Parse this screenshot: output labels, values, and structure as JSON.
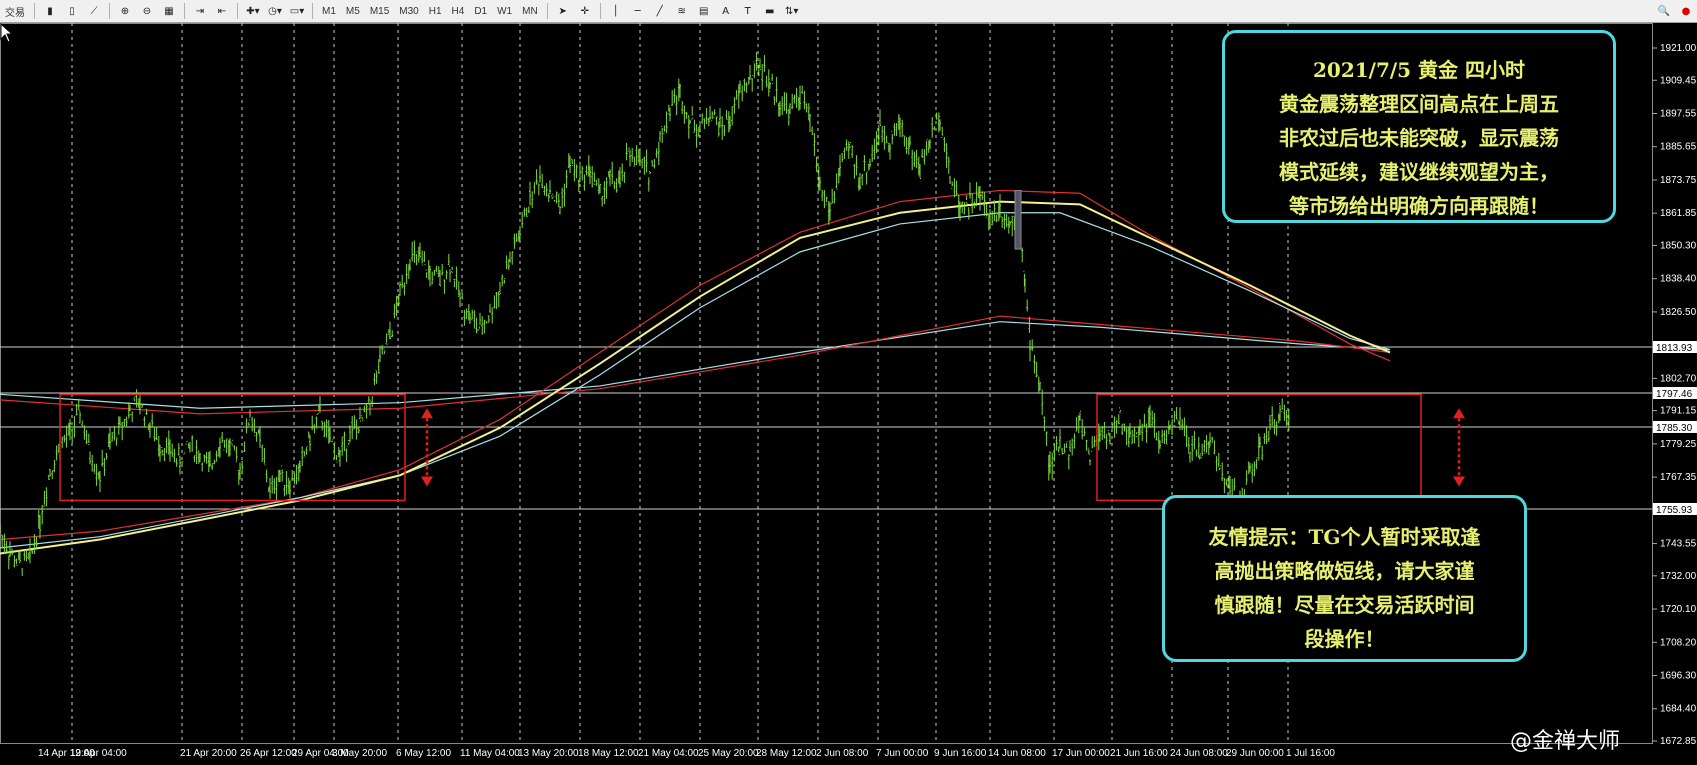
{
  "toolbar": {
    "left_label": "交易",
    "timeframes": [
      "M1",
      "M5",
      "M15",
      "M30",
      "H1",
      "H4",
      "D1",
      "W1",
      "MN"
    ],
    "text_tool": "A",
    "label_tool": "T"
  },
  "notes": {
    "top": {
      "lines": [
        "2021/7/5 黄金 四小时",
        "黄金震荡整理区间高点在上周五",
        "非农过后也未能突破，显示震荡",
        "模式延续，建议继续观望为主，",
        "等市场给出明确方向再跟随！"
      ]
    },
    "bottom": {
      "lines": [
        "友情提示：TG个人暂时采取逢",
        "高抛出策略做短线，请大家谨",
        "慎跟随！尽量在交易活跃时间",
        "段操作！"
      ]
    }
  },
  "watermark": "@金禅大师",
  "chart_data": {
    "type": "line",
    "ylim": [
      1672.85,
      1921.0
    ],
    "price_ticks": [
      1921.0,
      1909.45,
      1897.55,
      1885.65,
      1873.75,
      1861.85,
      1850.3,
      1838.4,
      1826.5,
      1802.7,
      1791.15,
      1779.25,
      1767.35,
      1755.45,
      1743.55,
      1732.0,
      1720.1,
      1708.2,
      1696.3,
      1684.4,
      1672.85
    ],
    "highlighted_prices": [
      1813.93,
      1797.46,
      1785.3,
      1755.93
    ],
    "x_labels": [
      "14 Apr 12:00",
      "19 Apr 04:00",
      "21 Apr 20:00",
      "26 Apr 12:00",
      "29 Apr 04:00",
      "3 May 20:00",
      "6 May 12:00",
      "11 May 04:00",
      "13 May 20:00",
      "18 May 12:00",
      "21 May 04:00",
      "25 May 20:00",
      "28 May 12:00",
      "2 Jun 08:00",
      "7 Jun 00:00",
      "9 Jun 16:00",
      "14 Jun 08:00",
      "17 Jun 00:00",
      "21 Jun 16:00",
      "24 Jun 08:00",
      "29 Jun 00:00",
      "1 Jul 16:00"
    ],
    "price_path": [
      [
        0,
        1748
      ],
      [
        10,
        1740
      ],
      [
        20,
        1736
      ],
      [
        30,
        1738
      ],
      [
        40,
        1752
      ],
      [
        50,
        1770
      ],
      [
        60,
        1778
      ],
      [
        70,
        1783
      ],
      [
        80,
        1790
      ],
      [
        90,
        1776
      ],
      [
        100,
        1768
      ],
      [
        110,
        1779
      ],
      [
        120,
        1785
      ],
      [
        130,
        1791
      ],
      [
        140,
        1794
      ],
      [
        150,
        1786
      ],
      [
        160,
        1779
      ],
      [
        170,
        1777
      ],
      [
        180,
        1773
      ],
      [
        190,
        1779
      ],
      [
        200,
        1775
      ],
      [
        210,
        1770
      ],
      [
        220,
        1781
      ],
      [
        230,
        1778
      ],
      [
        240,
        1770
      ],
      [
        250,
        1790
      ],
      [
        260,
        1780
      ],
      [
        270,
        1762
      ],
      [
        280,
        1768
      ],
      [
        290,
        1765
      ],
      [
        300,
        1770
      ],
      [
        310,
        1782
      ],
      [
        320,
        1790
      ],
      [
        330,
        1780
      ],
      [
        340,
        1775
      ],
      [
        350,
        1783
      ],
      [
        360,
        1786
      ],
      [
        370,
        1794
      ],
      [
        380,
        1808
      ],
      [
        390,
        1818
      ],
      [
        400,
        1833
      ],
      [
        410,
        1846
      ],
      [
        420,
        1845
      ],
      [
        430,
        1840
      ],
      [
        440,
        1838
      ],
      [
        450,
        1844
      ],
      [
        460,
        1832
      ],
      [
        470,
        1825
      ],
      [
        480,
        1820
      ],
      [
        490,
        1826
      ],
      [
        500,
        1835
      ],
      [
        510,
        1845
      ],
      [
        520,
        1855
      ],
      [
        530,
        1867
      ],
      [
        540,
        1875
      ],
      [
        550,
        1870
      ],
      [
        560,
        1864
      ],
      [
        570,
        1880
      ],
      [
        580,
        1874
      ],
      [
        590,
        1878
      ],
      [
        600,
        1868
      ],
      [
        610,
        1874
      ],
      [
        620,
        1872
      ],
      [
        630,
        1884
      ],
      [
        640,
        1880
      ],
      [
        650,
        1876
      ],
      [
        660,
        1888
      ],
      [
        670,
        1900
      ],
      [
        680,
        1905
      ],
      [
        690,
        1895
      ],
      [
        700,
        1892
      ],
      [
        710,
        1898
      ],
      [
        720,
        1893
      ],
      [
        730,
        1895
      ],
      [
        740,
        1905
      ],
      [
        750,
        1910
      ],
      [
        760,
        1915
      ],
      [
        770,
        1908
      ],
      [
        780,
        1902
      ],
      [
        790,
        1898
      ],
      [
        800,
        1905
      ],
      [
        810,
        1895
      ],
      [
        820,
        1872
      ],
      [
        830,
        1862
      ],
      [
        840,
        1878
      ],
      [
        850,
        1885
      ],
      [
        860,
        1874
      ],
      [
        870,
        1880
      ],
      [
        880,
        1892
      ],
      [
        890,
        1888
      ],
      [
        900,
        1894
      ],
      [
        910,
        1885
      ],
      [
        920,
        1878
      ],
      [
        930,
        1888
      ],
      [
        940,
        1898
      ],
      [
        950,
        1875
      ],
      [
        960,
        1865
      ],
      [
        970,
        1866
      ],
      [
        980,
        1868
      ],
      [
        990,
        1860
      ],
      [
        1000,
        1864
      ],
      [
        1010,
        1858
      ],
      [
        1020,
        1862
      ],
      [
        1025,
        1836
      ],
      [
        1030,
        1816
      ],
      [
        1040,
        1800
      ],
      [
        1050,
        1770
      ],
      [
        1060,
        1780
      ],
      [
        1070,
        1776
      ],
      [
        1080,
        1788
      ],
      [
        1090,
        1775
      ],
      [
        1100,
        1784
      ],
      [
        1110,
        1782
      ],
      [
        1120,
        1788
      ],
      [
        1130,
        1781
      ],
      [
        1140,
        1785
      ],
      [
        1150,
        1788
      ],
      [
        1160,
        1779
      ],
      [
        1170,
        1785
      ],
      [
        1180,
        1787
      ],
      [
        1190,
        1778
      ],
      [
        1200,
        1776
      ],
      [
        1210,
        1781
      ],
      [
        1220,
        1770
      ],
      [
        1230,
        1765
      ],
      [
        1240,
        1756
      ],
      [
        1250,
        1770
      ],
      [
        1260,
        1776
      ],
      [
        1270,
        1784
      ],
      [
        1280,
        1791
      ],
      [
        1290,
        1785
      ]
    ]
  },
  "colors": {
    "bullish": "#7fdf3a",
    "ma_yellow": "#f4f08a",
    "ma_red": "#e03030",
    "ma_cyan": "#a8e0e8",
    "box": "#e02020",
    "note_border": "#4fd8e0",
    "note_text": "#e8f070"
  }
}
